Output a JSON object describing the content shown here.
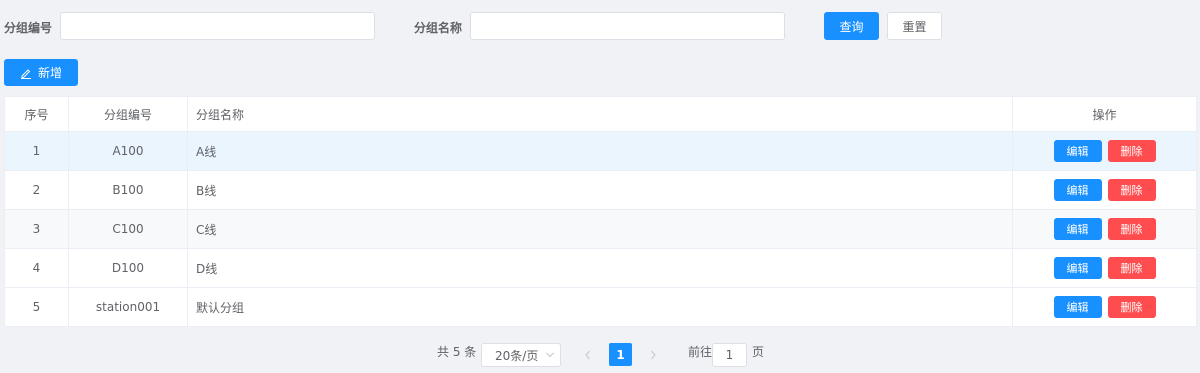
{
  "search": {
    "group_no_label": "分组编号",
    "group_no_value": "",
    "group_name_label": "分组名称",
    "group_name_value": "",
    "query_label": "查询",
    "reset_label": "重置"
  },
  "toolbar": {
    "add_label": "新增",
    "add_icon": "edit-icon"
  },
  "table": {
    "columns": [
      "序号",
      "分组编号",
      "分组名称",
      "操作"
    ],
    "rows": [
      {
        "index": "1",
        "code": "A100",
        "name": "A线"
      },
      {
        "index": "2",
        "code": "B100",
        "name": "B线"
      },
      {
        "index": "3",
        "code": "C100",
        "name": "C线"
      },
      {
        "index": "4",
        "code": "D100",
        "name": "D线"
      },
      {
        "index": "5",
        "code": "station001",
        "name": "默认分组"
      }
    ],
    "edit_label": "编辑",
    "delete_label": "删除"
  },
  "pagination": {
    "total_text": "共 5 条",
    "page_size": "20条/页",
    "current_page": "1",
    "goto_prefix": "前往",
    "goto_value": "1",
    "goto_suffix": "页"
  },
  "colors": {
    "primary": "#1890ff",
    "danger": "#ff4d4f",
    "link": "#3a7fc1"
  }
}
